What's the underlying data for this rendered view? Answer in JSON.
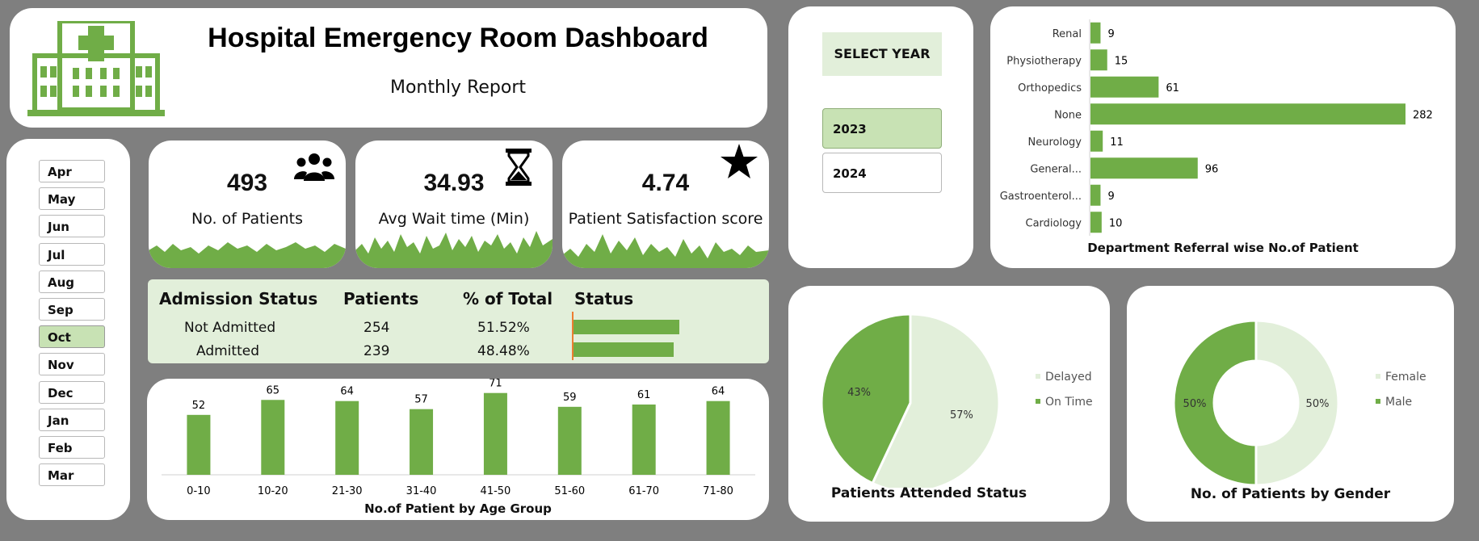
{
  "header": {
    "title": "Hospital Emergency Room Dashboard",
    "subtitle": "Monthly Report",
    "logo_icon": "hospital-icon"
  },
  "months": {
    "items": [
      "Apr",
      "May",
      "Jun",
      "Jul",
      "Aug",
      "Sep",
      "Oct",
      "Nov",
      "Dec",
      "Jan",
      "Feb",
      "Mar"
    ],
    "selected": "Oct"
  },
  "kpis": [
    {
      "value": "493",
      "label": "No. of Patients",
      "icon": "people-icon"
    },
    {
      "value": "34.93",
      "label": "Avg Wait time (Min)",
      "icon": "hourglass-icon"
    },
    {
      "value": "4.74",
      "label": "Patient Satisfaction score",
      "icon": "star-icon"
    }
  ],
  "admission": {
    "headers": [
      "Admission Status",
      "Patients",
      "% of Total",
      "Status"
    ],
    "rows": [
      {
        "status": "Not Admitted",
        "patients": "254",
        "pct": "51.52%",
        "fraction": 0.5152
      },
      {
        "status": "Admitted",
        "patients": "239",
        "pct": "48.48%",
        "fraction": 0.4848
      }
    ]
  },
  "year_slicer": {
    "title": "SELECT YEAR",
    "options": [
      "2023",
      "2024"
    ],
    "selected": "2023"
  },
  "colors": {
    "accent": "#70ad47",
    "light": "#e2efda",
    "selected": "#c8e2b4",
    "background": "#7f7f7f"
  },
  "age_chart": {
    "title": "No.of Patient by Age Group",
    "chart_data": {
      "type": "bar",
      "categories": [
        "0-10",
        "10-20",
        "21-30",
        "31-40",
        "41-50",
        "51-60",
        "61-70",
        "71-80"
      ],
      "values": [
        52,
        65,
        64,
        57,
        71,
        59,
        61,
        64
      ],
      "ylim": [
        0,
        75
      ]
    }
  },
  "dept_chart": {
    "title": "Department Referral wise No.of Patient",
    "chart_data": {
      "type": "bar",
      "orientation": "horizontal",
      "categories": [
        "Renal",
        "Physiotherapy",
        "Orthopedics",
        "None",
        "Neurology",
        "General...",
        "Gastroenterol...",
        "Cardiology"
      ],
      "values": [
        9,
        15,
        61,
        282,
        11,
        96,
        9,
        10
      ]
    }
  },
  "attended_chart": {
    "title": "Patients Attended Status",
    "chart_data": {
      "type": "pie",
      "categories": [
        "Delayed",
        "On Time"
      ],
      "values": [
        57,
        43
      ],
      "labels": [
        "57%",
        "43%"
      ],
      "legend": "right"
    }
  },
  "gender_chart": {
    "title": "No. of Patients by Gender",
    "chart_data": {
      "type": "pie",
      "subtype": "donut",
      "categories": [
        "Female",
        "Male"
      ],
      "values": [
        50,
        50
      ],
      "labels": [
        "50%",
        "50%"
      ],
      "legend": "right"
    }
  }
}
